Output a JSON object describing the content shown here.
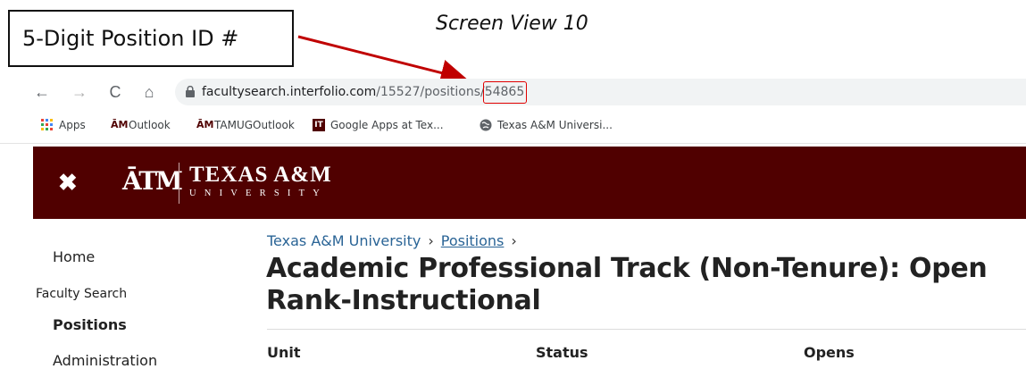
{
  "annotation": {
    "box_label": "5-Digit Position ID #",
    "caption": "Screen View 10",
    "arrow_color": "#c00000",
    "highlight_color": "#e00000"
  },
  "browser": {
    "nav_icons": [
      "back-arrow-icon",
      "forward-arrow-icon",
      "reload-icon",
      "home-icon"
    ],
    "url_domain": "facultysearch.interfolio.com",
    "url_path": "/15527/positions/",
    "url_id": "54865",
    "bookmarks": [
      {
        "label": "Apps",
        "icon": "apps-grid-icon"
      },
      {
        "label": "Outlook",
        "icon": "tam-logo-icon"
      },
      {
        "label": "TAMUGOutlook",
        "icon": "tam-logo-icon"
      },
      {
        "label": "Google Apps at Tex...",
        "icon": "it-logo-icon"
      },
      {
        "label": "Texas A&M Universi...",
        "icon": "globe-icon"
      }
    ]
  },
  "header": {
    "brand_color": "#500000",
    "logo_mark": "ĀTM",
    "logo_line1": "TEXAS A&M",
    "logo_line2": "UNIVERSITY"
  },
  "sidebar": {
    "home": "Home",
    "section": "Faculty Search",
    "positions": "Positions",
    "administration": "Administration"
  },
  "main": {
    "breadcrumb_root": "Texas A&M University",
    "breadcrumb_link": "Positions",
    "title": "Academic Professional Track (Non-Tenure): Open Rank-Instructional",
    "columns": [
      "Unit",
      "Status",
      "Opens"
    ]
  }
}
